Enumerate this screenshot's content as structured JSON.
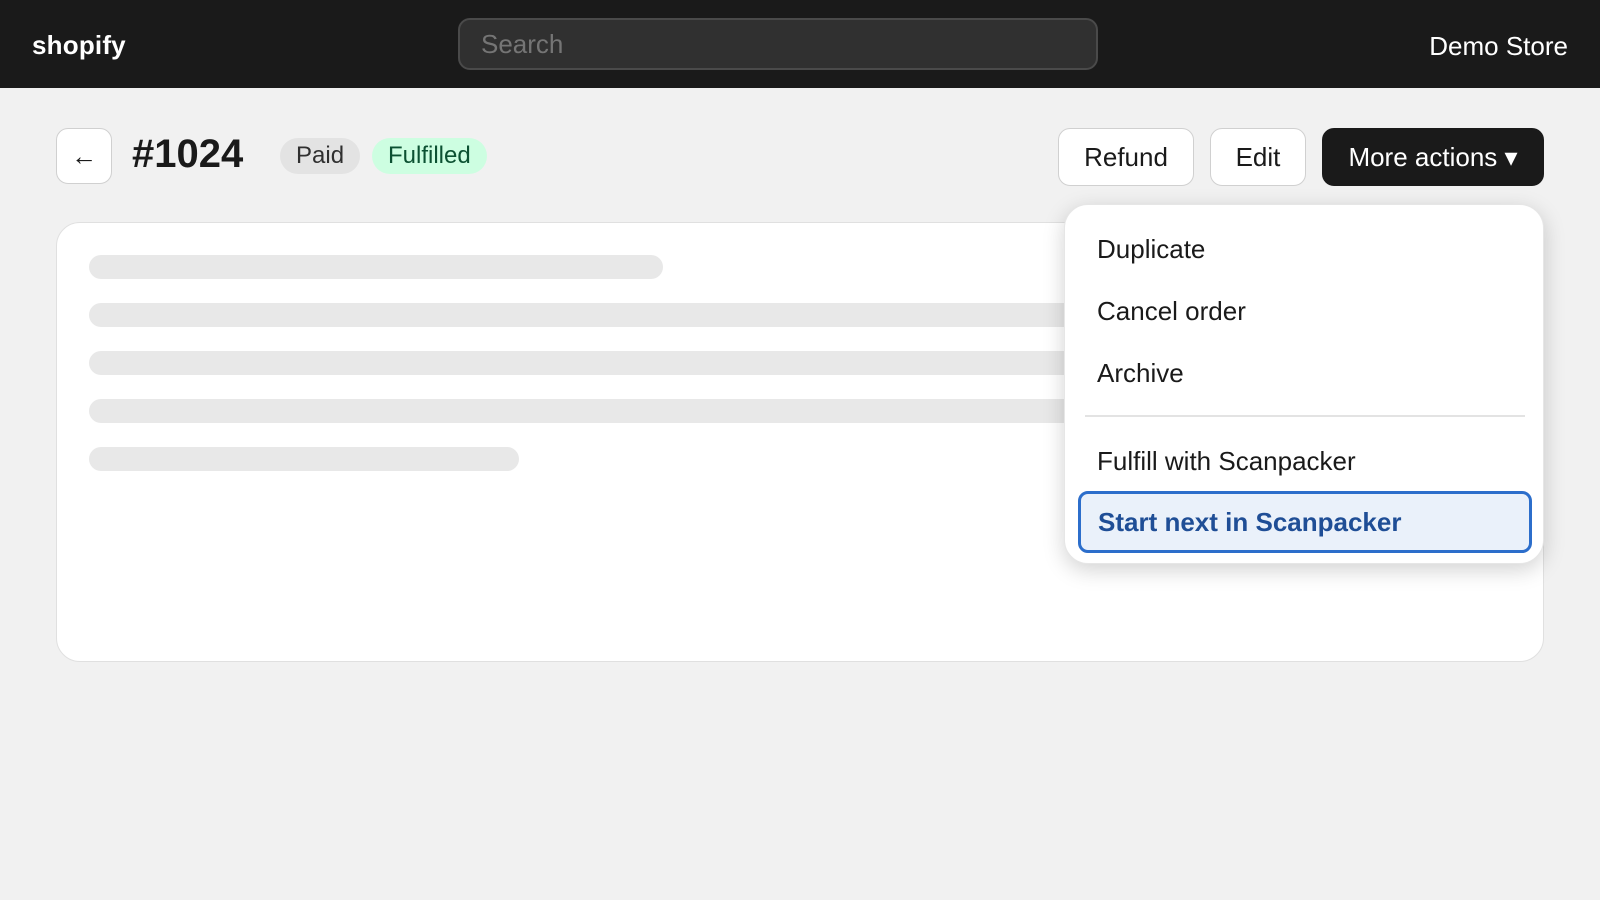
{
  "topbar": {
    "logo": "shopify",
    "search_placeholder": "Search",
    "store_name": "Demo Store"
  },
  "order": {
    "back_icon": "←",
    "title": "#1024",
    "badges": [
      {
        "label": "Paid",
        "color": "#e3e3e3"
      },
      {
        "label": "Fulfilled",
        "color": "#cdfee1"
      }
    ]
  },
  "actions": {
    "refund": "Refund",
    "edit": "Edit",
    "more": "More actions ▾"
  },
  "menu": {
    "items": [
      {
        "label": "Duplicate"
      },
      {
        "label": "Cancel order"
      },
      {
        "label": "Archive"
      },
      {
        "label": "Fulfill with Scanpacker"
      },
      {
        "label": "Start next in Scanpacker",
        "focused": true
      }
    ],
    "focus_color": "#2c6ecb"
  },
  "theme": {
    "topbar_bg": "#1a1a1a",
    "page_bg": "#f1f1f1",
    "primary_button_bg": "#1a1a1a"
  }
}
